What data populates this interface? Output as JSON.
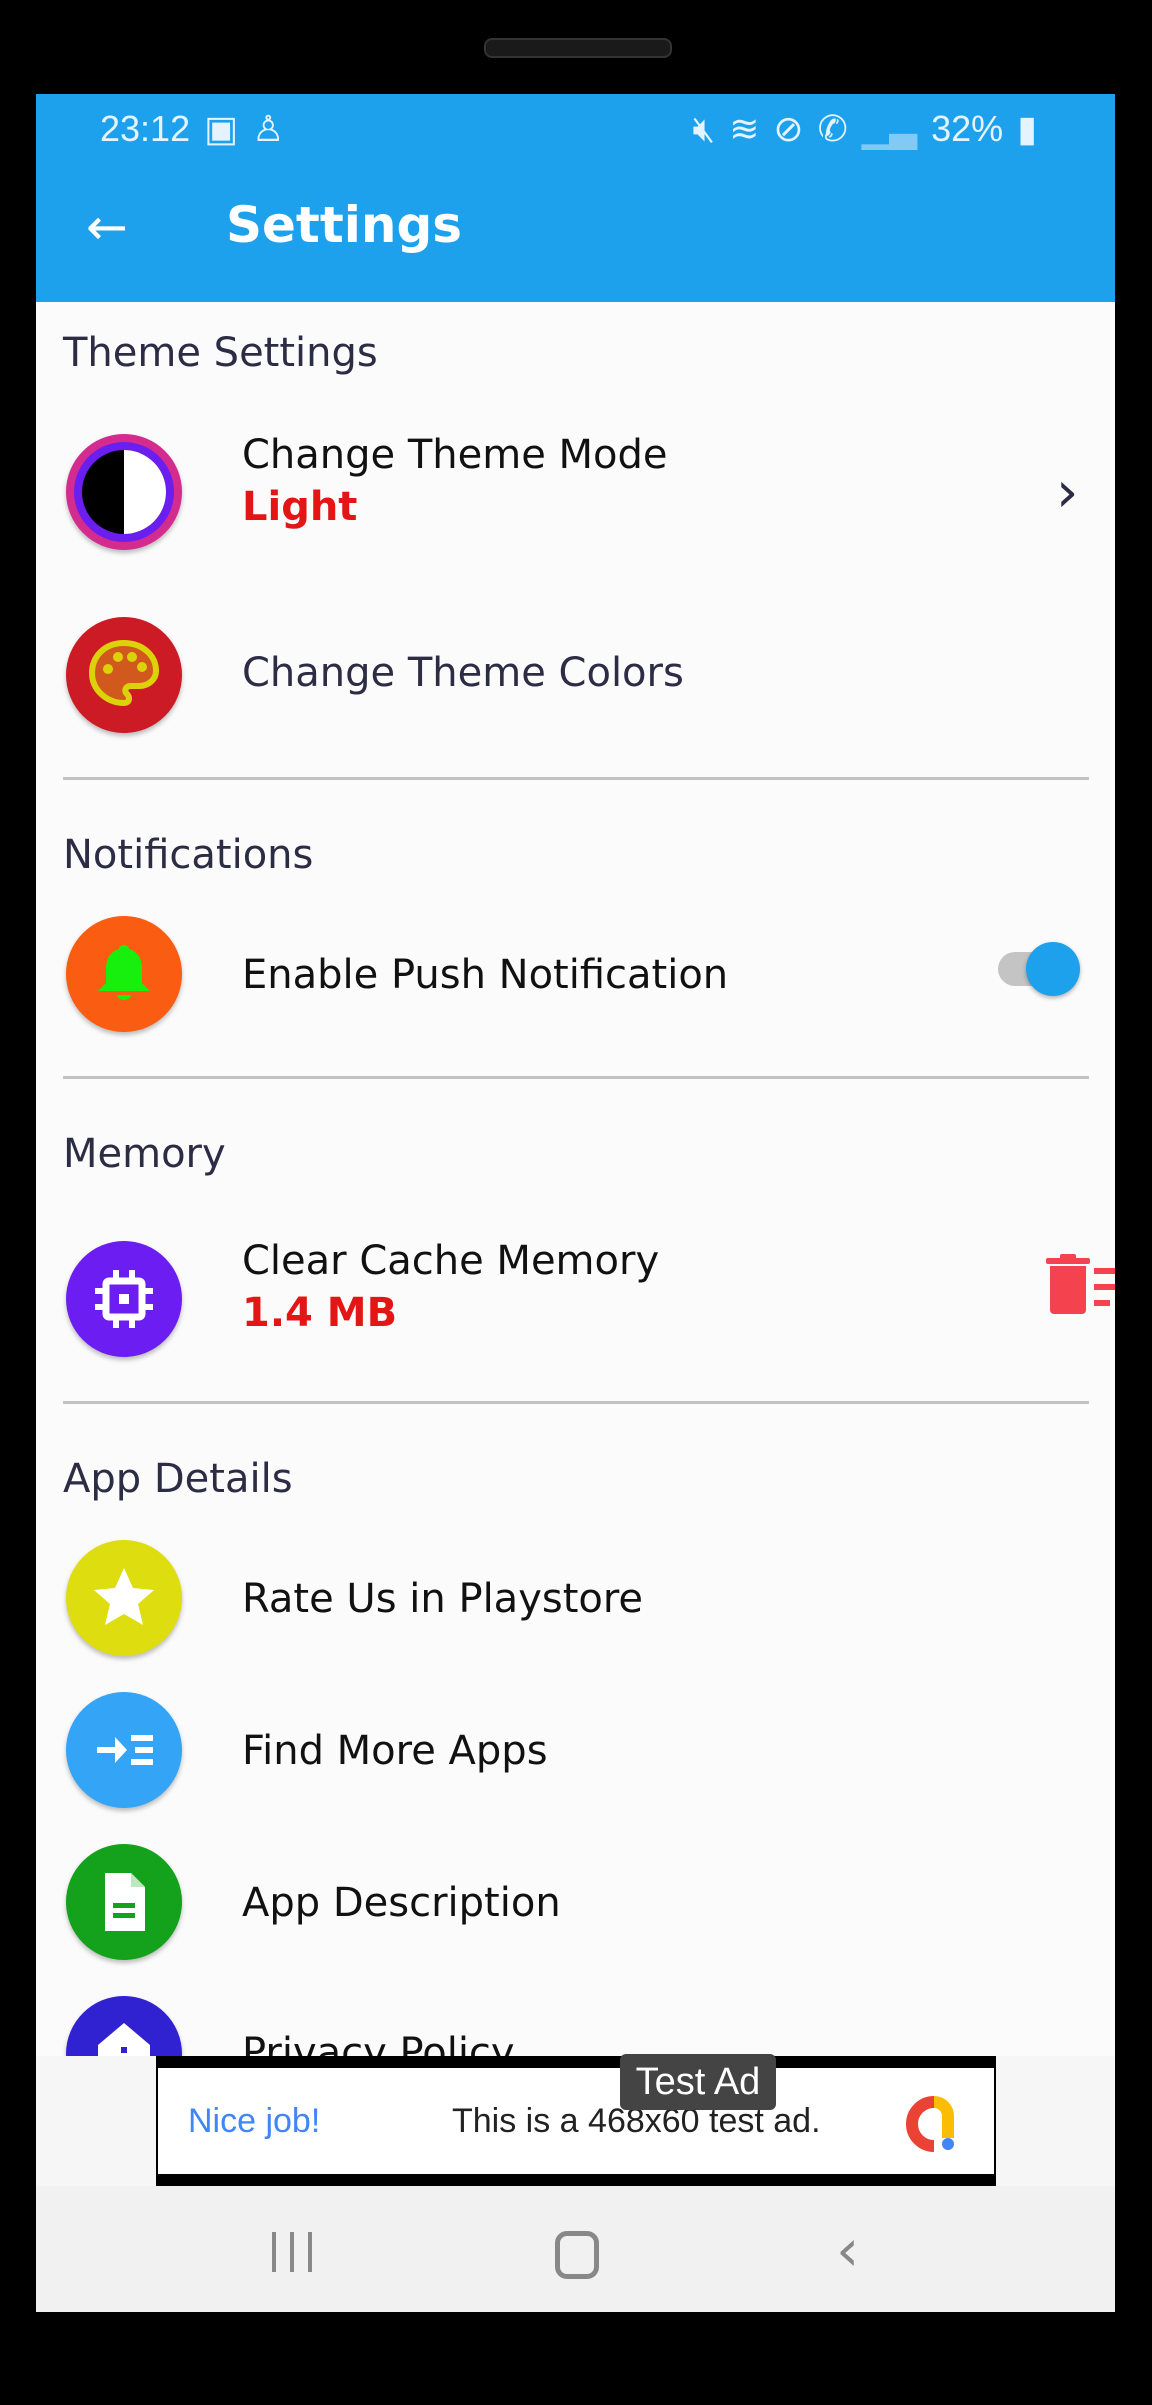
{
  "status_bar": {
    "time": "23:12",
    "battery": "32%",
    "icons": [
      "radio-icon",
      "accessibility-icon",
      "mute-icon",
      "wifi-icon",
      "dnd-icon",
      "wifi-call-icon",
      "signal-icon",
      "battery-charging-icon"
    ]
  },
  "app_bar": {
    "title": "Settings",
    "back_icon": "arrow-left-icon"
  },
  "colors": {
    "accent": "#1ea1ed",
    "value_red": "#e41515"
  },
  "sections": [
    {
      "title": "Theme Settings",
      "items": [
        {
          "label": "Change Theme Mode",
          "value": "Light"
        },
        {
          "label": "Change Theme Colors"
        }
      ]
    },
    {
      "title": "Notifications",
      "items": [
        {
          "label": "Enable Push Notification",
          "toggle_on": true
        }
      ]
    },
    {
      "title": "Memory",
      "items": [
        {
          "label": "Clear Cache Memory",
          "value": "1.4 MB"
        }
      ]
    },
    {
      "title": "App Details",
      "items": [
        {
          "label": "Rate Us in Playstore"
        },
        {
          "label": "Find More Apps"
        },
        {
          "label": "App Description"
        },
        {
          "label": "Privacy Policy"
        }
      ]
    }
  ],
  "ad": {
    "badge": "Test Ad",
    "headline": "Nice job!",
    "text": "This is a 468x60 test ad."
  }
}
